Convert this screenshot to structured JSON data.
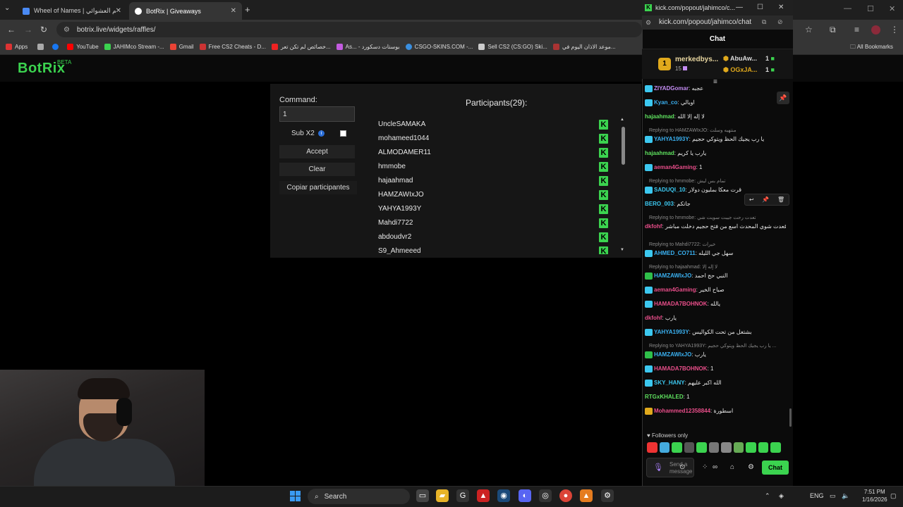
{
  "browser": {
    "tabs": [
      {
        "title": "Wheel of Names | عجلة الاسم العشوائي",
        "active": false
      },
      {
        "title": "BotRix | Giveaways",
        "active": true
      }
    ],
    "url": "botrix.live/widgets/raffles/",
    "bookmarks": [
      "Apps",
      "YouTube",
      "JAHIMco Stream -...",
      "Gmail",
      "Free CS2 Cheats - D...",
      "خصائص لم تكن تعر...",
      "As... - بوستات دسكورد",
      "CSGO-SKINS.COM -...",
      "Sell CS2 (CS:GO) Ski...",
      "موعد الاذان اليوم في..."
    ],
    "all_bookmarks": "All Bookmarks"
  },
  "botrix": {
    "logo": "BotRix",
    "beta": "BETA",
    "command_label": "Command:",
    "command_value": "1",
    "sub_label": "Sub X2",
    "accept_label": "Accept",
    "clear_label": "Clear",
    "copy_label": "Copiar participantes",
    "participants_title": "Participants(29):",
    "participants": [
      "UncleSAMAKA",
      "mohameed1044",
      "ALMODAMER11",
      "hmmobe",
      "hajaahmad",
      "HAMZAWIxJO",
      "YAHYA1993Y",
      "Mahdi7722",
      "abdoudvr2",
      "S9_Ahmeeed"
    ]
  },
  "kick": {
    "window_title": "kick.com/popout/jahimco/c...",
    "url": "kick.com/popout/jahimco/chat",
    "chat_header": "Chat",
    "leaderboard": {
      "first_name": "merkedbys...",
      "first_count": "15",
      "first_rank": "1",
      "second_name": "AbuAw...",
      "second_count": "1",
      "third_name": "OGxJA...",
      "third_count": "1"
    },
    "messages": [
      {
        "user": "ZIYADGomar",
        "text": "عجبه",
        "color": "#c38cf2",
        "badge": "#3cc8f0"
      },
      {
        "user": "Kyan_co",
        "text": "اوبالي",
        "color": "#3ab0f0",
        "badge": "#3cc8f0"
      },
      {
        "user": "hajaahmad",
        "text": "لا إله إلا الله",
        "color": "#5ee05e",
        "badge": ""
      },
      {
        "reply": "Replying to HAMZAWIxJO: منتهيه وسلت"
      },
      {
        "user": "YAHYA1993Y",
        "text": "يا رب يجيك الحظ ويتوكي حجيم",
        "color": "#3ab0f0",
        "badge": "#3cc8f0"
      },
      {
        "user": "hajaahmad",
        "text": "يارب يا كريم",
        "color": "#5ee05e",
        "badge": ""
      },
      {
        "user": "aeman4Gaming",
        "text": "1",
        "color": "#e94e8a",
        "badge": "#3cc8f0"
      },
      {
        "reply": "Replying to hmmobe: تمام بس ليش"
      },
      {
        "user": "SADUQI_10",
        "text": "قرت معكا بمليون دولار",
        "color": "#3cc8f0",
        "badge": "#3cc8f0"
      },
      {
        "user": "BERO_003",
        "text": "جاتكم",
        "color": "#3cc8f0",
        "badge": ""
      },
      {
        "reply": "Replying to hmmobe: تعدت رحت جيبت سويت شي"
      },
      {
        "user": "dkfohf",
        "text": "والله زاد اني قعدت شوي المحدث اسع من فتح حجيم دخلت مباشر",
        "color": "#e94e8a",
        "badge": ""
      },
      {
        "reply": "Replying to Mahdi7722: خيرات"
      },
      {
        "user": "AHMED_CO711",
        "text": "سهل جي الليله",
        "color": "#3ab0f0",
        "badge": "#3cc8f0"
      },
      {
        "reply": "Replying to hajaahmad: لا إله إلا"
      },
      {
        "user": "HAMZAWIxJO",
        "text": "النبي حج احمد",
        "color": "#3ab0f0",
        "badge": "#2fbf4a"
      },
      {
        "user": "aeman4Gaming",
        "text": "صباح الخير",
        "color": "#e94e8a",
        "badge": "#3cc8f0"
      },
      {
        "user": "HAMADA7BOHNOK",
        "text": "يالله",
        "color": "#e94e8a",
        "badge": "#3cc8f0"
      },
      {
        "user": "dkfohf",
        "text": "يارب",
        "color": "#e94e8a",
        "badge": ""
      },
      {
        "user": "YAHYA1993Y",
        "text": "بشتغل من تحت الكواليس",
        "color": "#3ab0f0",
        "badge": "#3cc8f0"
      },
      {
        "reply": "Replying to YAHYA1993Y: يا رب يجيك الحظ ويتوكي حجيم ..."
      },
      {
        "user": "HAMZAWIxJO",
        "text": "يارب",
        "color": "#3ab0f0",
        "badge": "#2fbf4a"
      },
      {
        "user": "HAMADA7BOHNOK",
        "text": "1",
        "color": "#e94e8a",
        "badge": "#3cc8f0"
      },
      {
        "user": "SKY_HANY",
        "text": "الله اكبر عليهم",
        "color": "#3cc8f0",
        "badge": "#3cc8f0"
      },
      {
        "user": "RTGxKHALED",
        "text": "1",
        "color": "#5ee05e",
        "badge": ""
      },
      {
        "user": "Mohammed12358844",
        "text": "اسطورة",
        "color": "#e94e8a",
        "badge": "#e0a91c"
      }
    ],
    "followers_only": "Followers only",
    "send_placeholder": "Send a message",
    "chat_button": "Chat"
  },
  "taskbar": {
    "search": "Search",
    "lang": "ENG",
    "time": "7:51 PM",
    "date": "1/16/2026"
  }
}
